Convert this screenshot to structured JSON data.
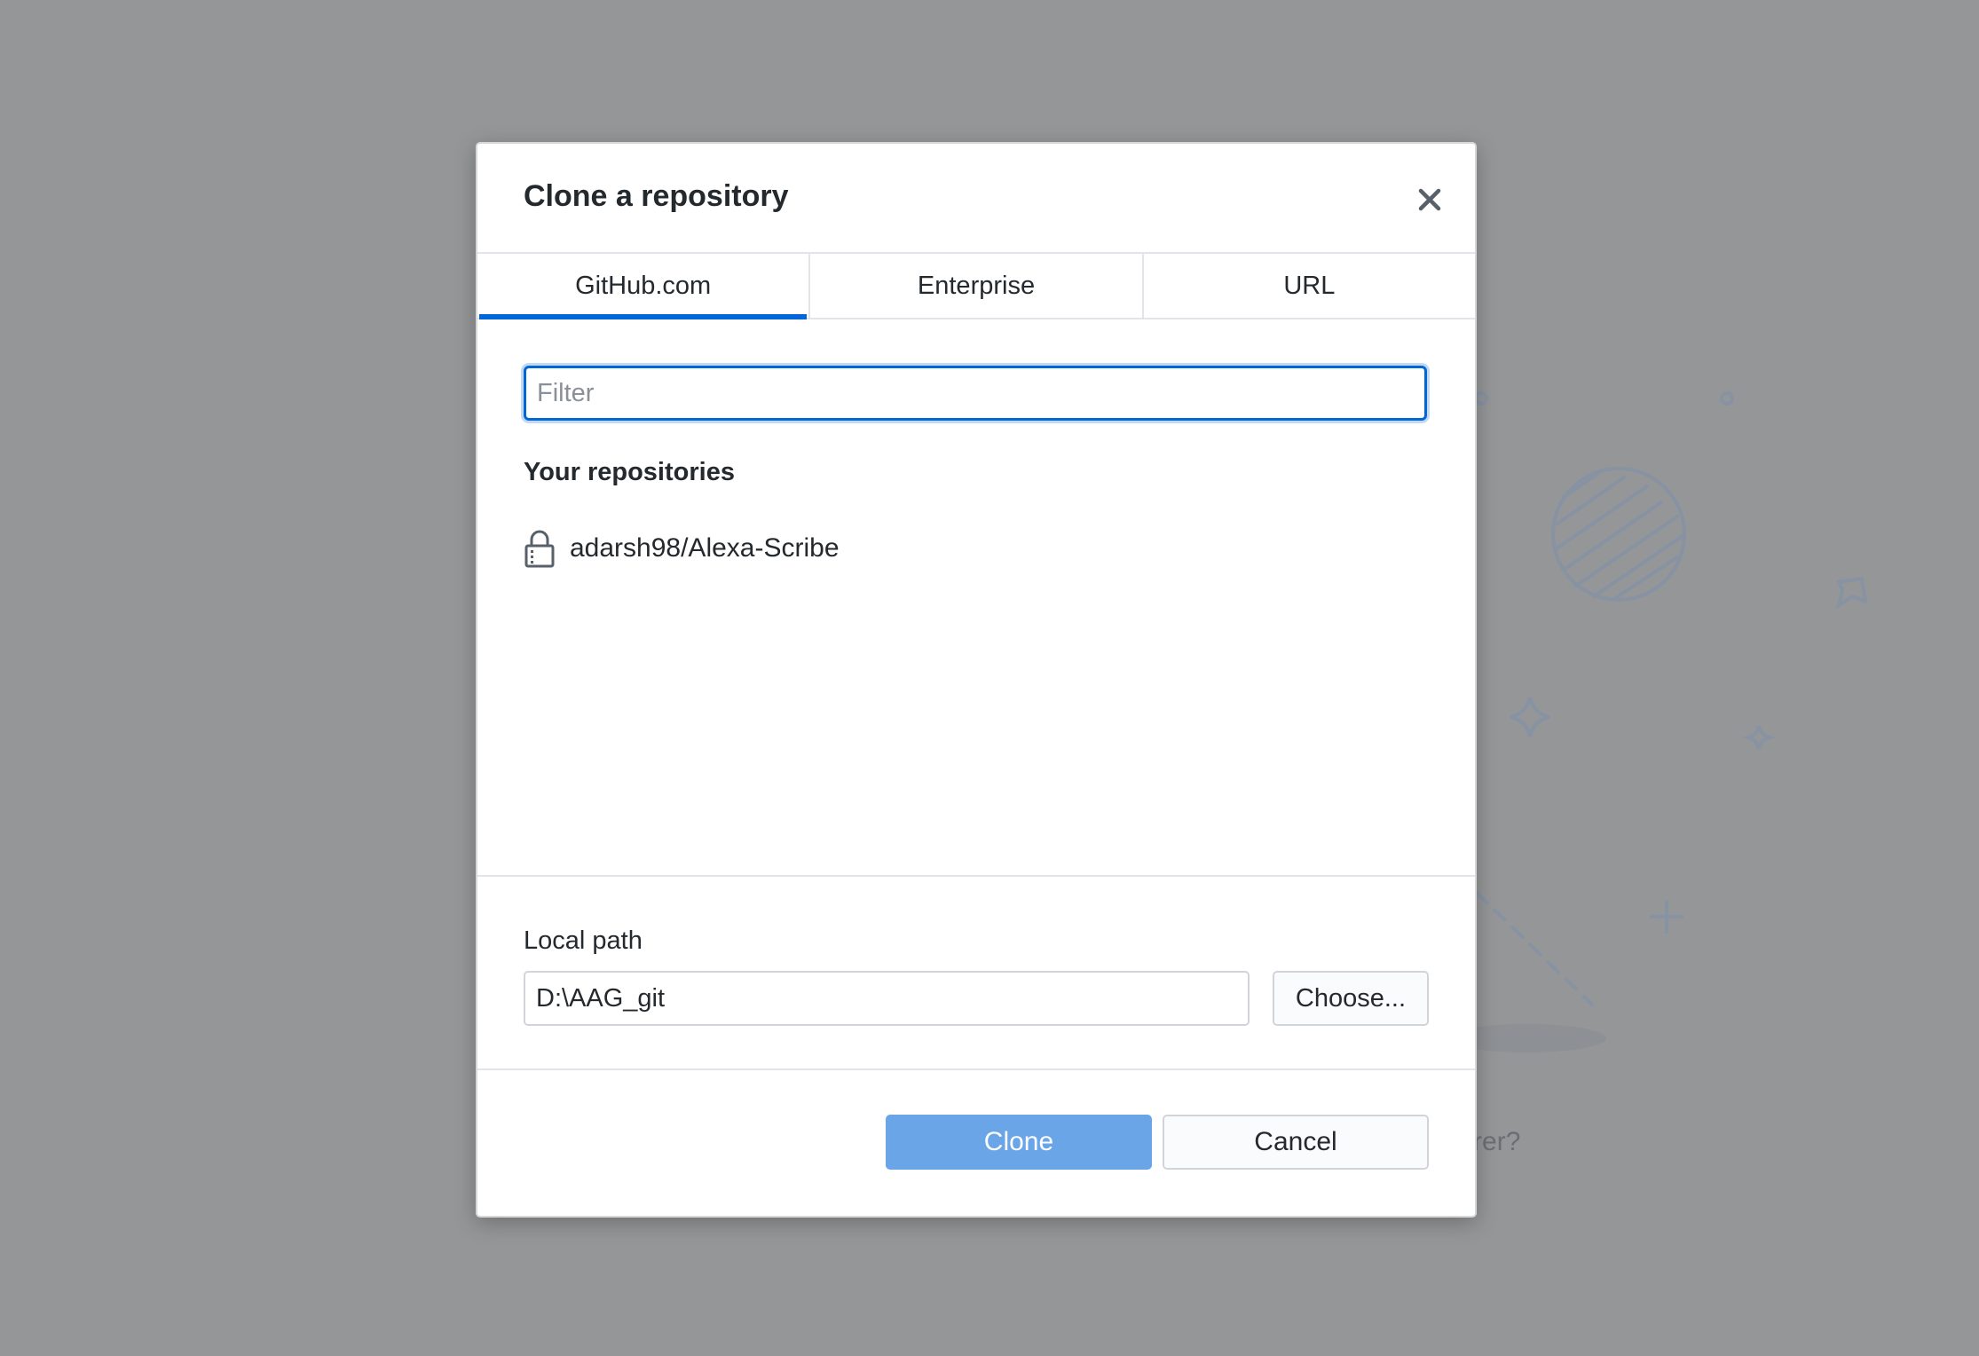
{
  "background": {
    "hint_text_partial": "plorer?",
    "colors": {
      "overlay": "#959697",
      "illustration": "#8792a3"
    }
  },
  "dialog": {
    "title": "Clone a repository",
    "close_icon": "close-icon",
    "tabs": [
      {
        "label": "GitHub.com",
        "selected": true
      },
      {
        "label": "Enterprise",
        "selected": false
      },
      {
        "label": "URL",
        "selected": false
      }
    ],
    "filter": {
      "placeholder": "Filter",
      "value": ""
    },
    "repositories": {
      "heading": "Your repositories",
      "items": [
        {
          "name": "adarsh98/Alexa-Scribe",
          "icon": "lock-icon",
          "private": true
        }
      ]
    },
    "local_path": {
      "label": "Local path",
      "value": "D:\\AAG_git",
      "choose_label": "Choose..."
    },
    "footer": {
      "clone_label": "Clone",
      "cancel_label": "Cancel"
    },
    "colors": {
      "accent": "#0366d6",
      "primary_button": "#6aa5e8",
      "text": "#24292e",
      "border": "#e1e4e8"
    }
  }
}
